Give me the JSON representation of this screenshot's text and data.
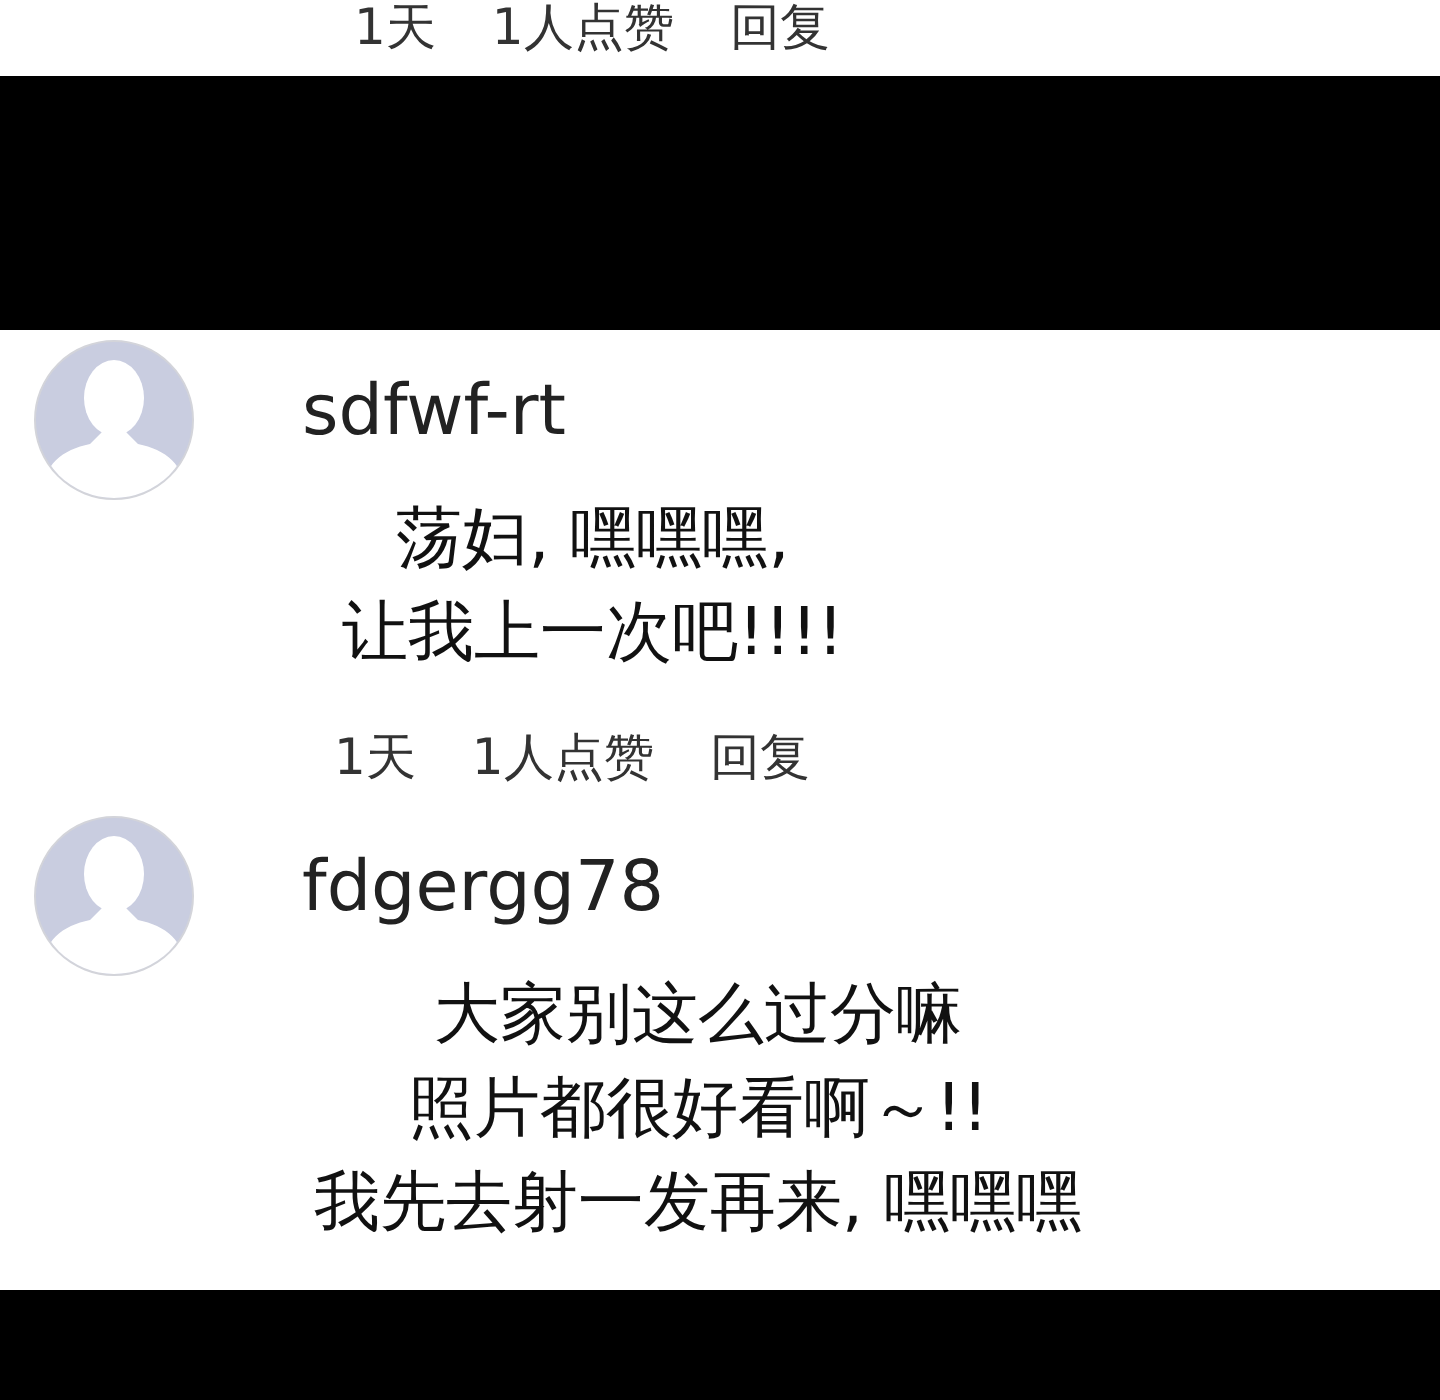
{
  "previous_comment": {
    "meta": {
      "time": "1天",
      "likes": "1人点赞",
      "reply": "回复"
    }
  },
  "comments": [
    {
      "username": "sdfwf-rt",
      "body": [
        "荡妇, 嘿嘿嘿,",
        "让我上一次吧!!!!"
      ],
      "meta": {
        "time": "1天",
        "likes": "1人点赞",
        "reply": "回复"
      }
    },
    {
      "username": "fdgergg78",
      "body": [
        "大家别这么过分嘛",
        "照片都很好看啊～!!",
        "我先去射一发再来, 嘿嘿嘿"
      ]
    }
  ]
}
